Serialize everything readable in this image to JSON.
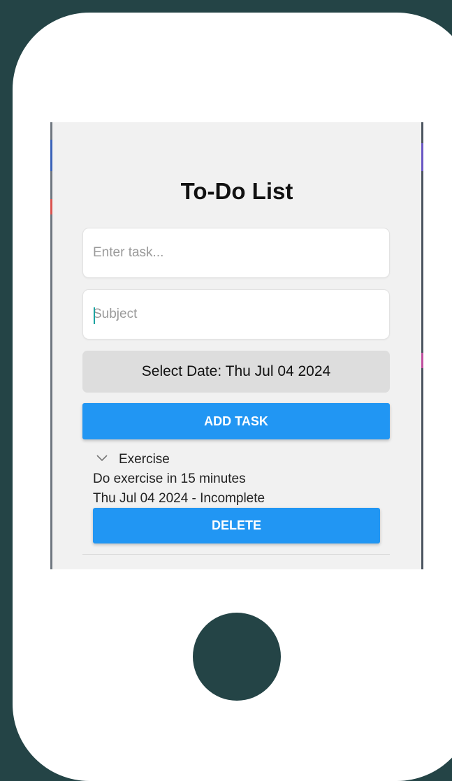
{
  "app": {
    "title": "To-Do List"
  },
  "form": {
    "task_input": {
      "placeholder": "Enter task...",
      "value": ""
    },
    "subject_input": {
      "placeholder": "Subject",
      "value": ""
    },
    "date_button_label": "Select Date: Thu Jul 04 2024",
    "add_button_label": "ADD TASK"
  },
  "tasks": [
    {
      "subject": "Exercise",
      "description": "Do exercise in 15 minutes",
      "date_status": "Thu Jul 04 2024 - Incomplete",
      "delete_label": "DELETE",
      "expand_icon": "chevron-down-icon"
    }
  ],
  "colors": {
    "background": "#244446",
    "device_frame": "#ffffff",
    "screen": "#f1f1f1",
    "primary_button": "#2196f3",
    "date_button": "#dddddd",
    "home_button": "#244446",
    "cursor": "#19a3a0"
  }
}
